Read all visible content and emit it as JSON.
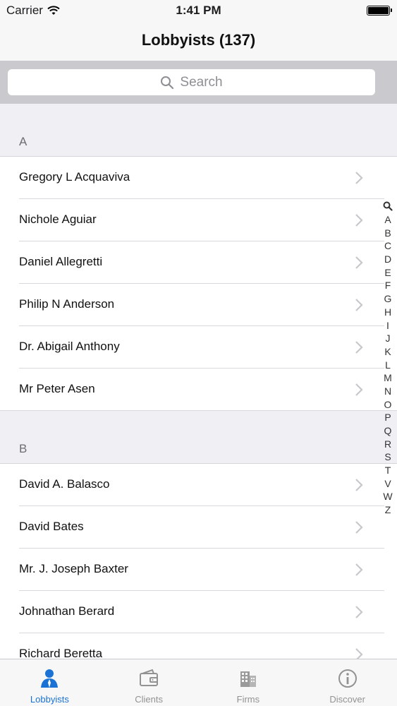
{
  "status_bar": {
    "carrier": "Carrier",
    "time": "1:41 PM"
  },
  "nav": {
    "title": "Lobbyists (137)"
  },
  "search": {
    "placeholder": "Search"
  },
  "sections": [
    {
      "letter": "A",
      "rows": [
        "Gregory L Acquaviva",
        "Nichole Aguiar",
        "Daniel Allegretti",
        "Philip N Anderson",
        "Dr. Abigail Anthony",
        "Mr Peter Asen"
      ]
    },
    {
      "letter": "B",
      "rows": [
        "David A. Balasco",
        "David Bates",
        "Mr. J. Joseph Baxter",
        "Johnathan Berard",
        "Richard Beretta"
      ]
    }
  ],
  "index_letters": [
    "A",
    "B",
    "C",
    "D",
    "E",
    "F",
    "G",
    "H",
    "I",
    "J",
    "K",
    "L",
    "M",
    "N",
    "O",
    "P",
    "Q",
    "R",
    "S",
    "T",
    "V",
    "W",
    "Z"
  ],
  "tabs": [
    {
      "label": "Lobbyists",
      "icon": "person-icon",
      "active": true
    },
    {
      "label": "Clients",
      "icon": "wallet-icon",
      "active": false
    },
    {
      "label": "Firms",
      "icon": "building-icon",
      "active": false
    },
    {
      "label": "Discover",
      "icon": "info-icon",
      "active": false
    }
  ],
  "colors": {
    "accent": "#1a73d4",
    "inactive": "#929292",
    "section_bg": "#efeff4"
  }
}
